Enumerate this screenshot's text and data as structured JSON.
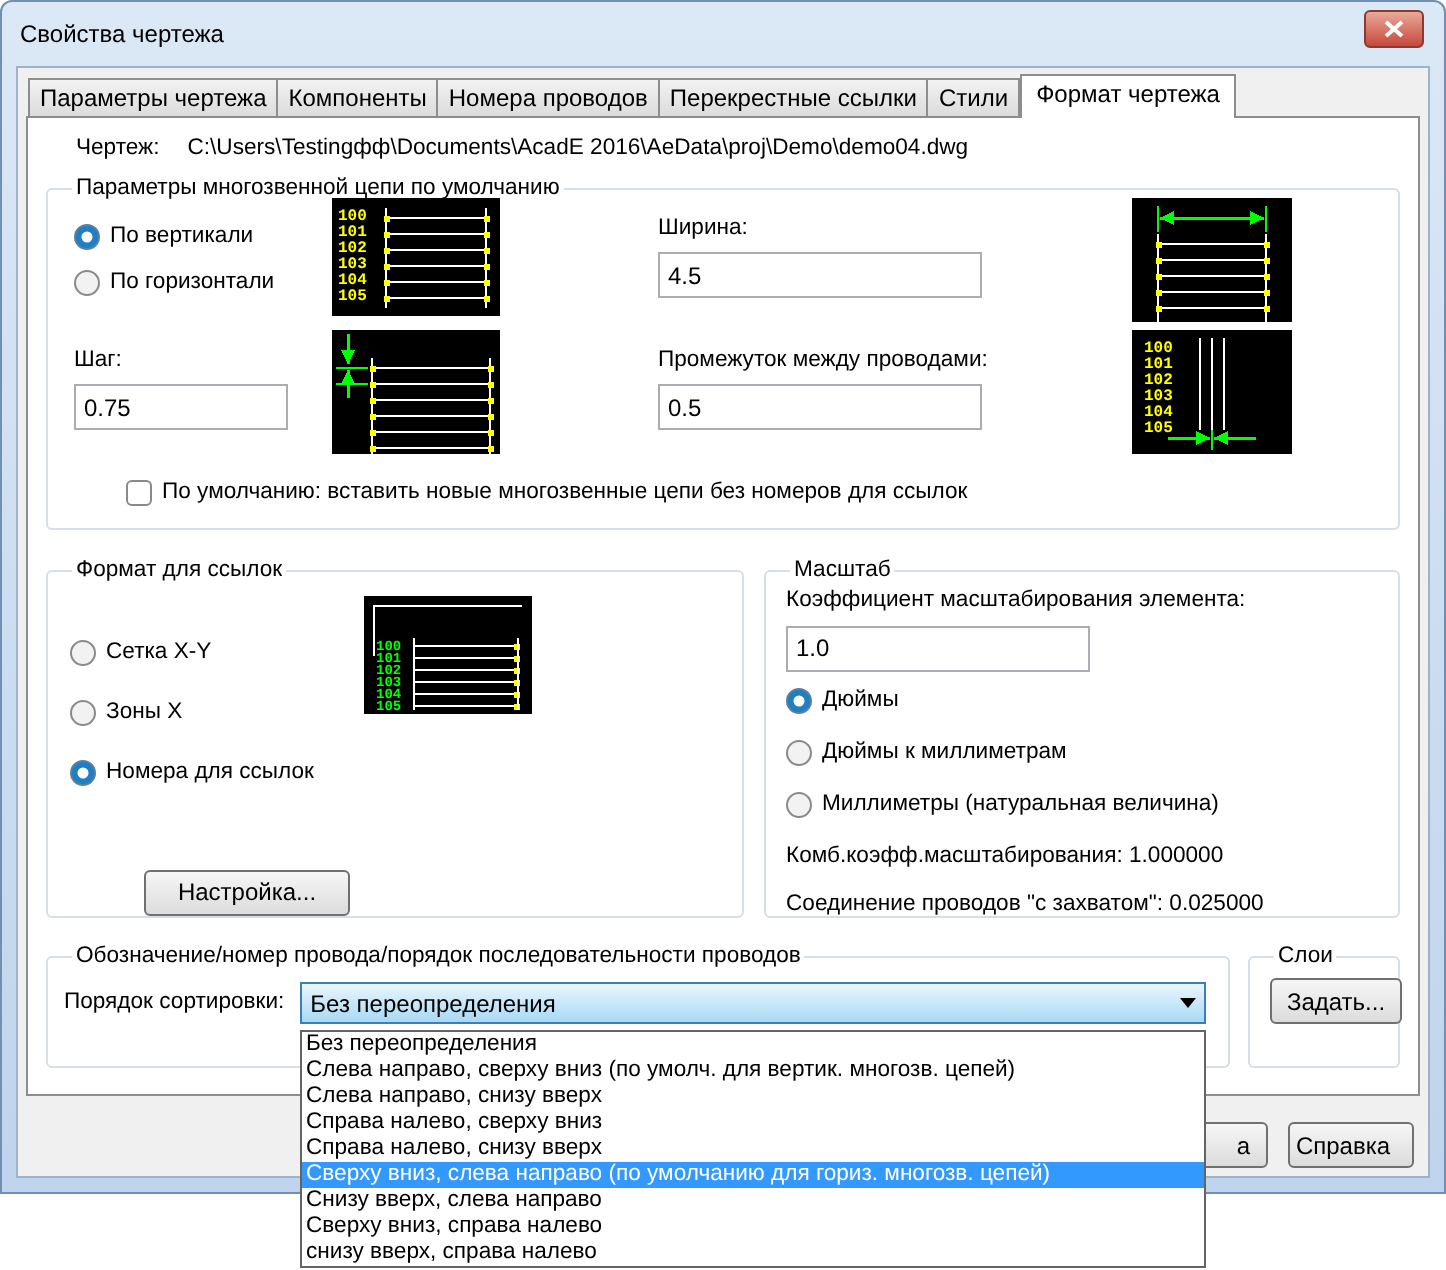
{
  "window": {
    "title": "Свойства чертежа"
  },
  "tabs": [
    {
      "label": "Параметры чертежа",
      "selected": false
    },
    {
      "label": "Компоненты",
      "selected": false
    },
    {
      "label": "Номера проводов",
      "selected": false
    },
    {
      "label": "Перекрестные ссылки",
      "selected": false
    },
    {
      "label": "Стили",
      "selected": false
    },
    {
      "label": "Формат чертежа",
      "selected": true
    }
  ],
  "drawing": {
    "label": "Чертеж:",
    "path": "C:\\Users\\Testingфф\\Documents\\AcadE 2016\\AeData\\proj\\Demo\\demo04.dwg"
  },
  "ladder_defaults": {
    "title": "Параметры многозвенной цепи по умолчанию",
    "orientation": [
      {
        "label": "По вертикали",
        "selected": true
      },
      {
        "label": "По горизонтали",
        "selected": false
      }
    ],
    "width": {
      "label": "Ширина:",
      "value": "4.5"
    },
    "spacing": {
      "label": "Шаг:",
      "value": "0.75"
    },
    "gap": {
      "label": "Промежуток между проводами:",
      "value": "0.5"
    },
    "diagrams": [
      {
        "kind": "rungs",
        "labels": [
          "100",
          "101",
          "102",
          "103",
          "104",
          "105"
        ]
      },
      {
        "kind": "width"
      },
      {
        "kind": "spacing"
      },
      {
        "kind": "gap",
        "labels": [
          "100",
          "101",
          "102",
          "103",
          "104",
          "105"
        ]
      }
    ],
    "no_ref_numbers": {
      "label": "По умолчанию: вставить новые многозвенные цепи без номеров для ссылок",
      "checked": false
    }
  },
  "reference_format": {
    "title": "Формат для ссылок",
    "options": [
      {
        "label": "Сетка X-Y",
        "selected": false
      },
      {
        "label": "Зоны X",
        "selected": false
      },
      {
        "label": "Номера для ссылок",
        "selected": true
      }
    ],
    "diagram": {
      "kind": "refnums",
      "labels": [
        "100",
        "101",
        "102",
        "103",
        "104",
        "105"
      ]
    },
    "button": "Настройка..."
  },
  "scale": {
    "title": "Масштаб",
    "factor": {
      "label": "Коэффициент масштабирования элемента:",
      "value": "1.0"
    },
    "units": [
      {
        "label": "Дюймы",
        "selected": true
      },
      {
        "label": "Дюймы к миллиметрам",
        "selected": false
      },
      {
        "label": "Миллиметры (натуральная величина)",
        "selected": false
      }
    ],
    "combined": "Комб.коэфф.масштабирования: 1.000000",
    "snap": "Соединение проводов \"с захватом\": 0.025000"
  },
  "wire_sequence": {
    "title": "Обозначение/номер провода/порядок последовательности проводов",
    "sort_label": "Порядок сортировки:",
    "sort_value": "Без переопределения",
    "dropdown_items": [
      {
        "label": "Без переопределения",
        "selected": false
      },
      {
        "label": "Слева направо, сверху вниз (по умолч. для вертик. многозв. цепей)",
        "selected": false
      },
      {
        "label": "Слева направо, снизу вверх",
        "selected": false
      },
      {
        "label": "Справа налево, сверху вниз",
        "selected": false
      },
      {
        "label": "Справа налево, снизу вверх",
        "selected": false
      },
      {
        "label": "Сверху вниз, слева направо (по умолчанию для гориз. многозв. цепей)",
        "selected": true
      },
      {
        "label": "Снизу вверх, слева направо",
        "selected": false
      },
      {
        "label": "Сверху вниз, справа налево",
        "selected": false
      },
      {
        "label": "снизу вверх, справа налево",
        "selected": false
      }
    ]
  },
  "layers": {
    "title": "Слои",
    "button": "Задать..."
  },
  "buttons": [
    "а",
    "Справка"
  ]
}
